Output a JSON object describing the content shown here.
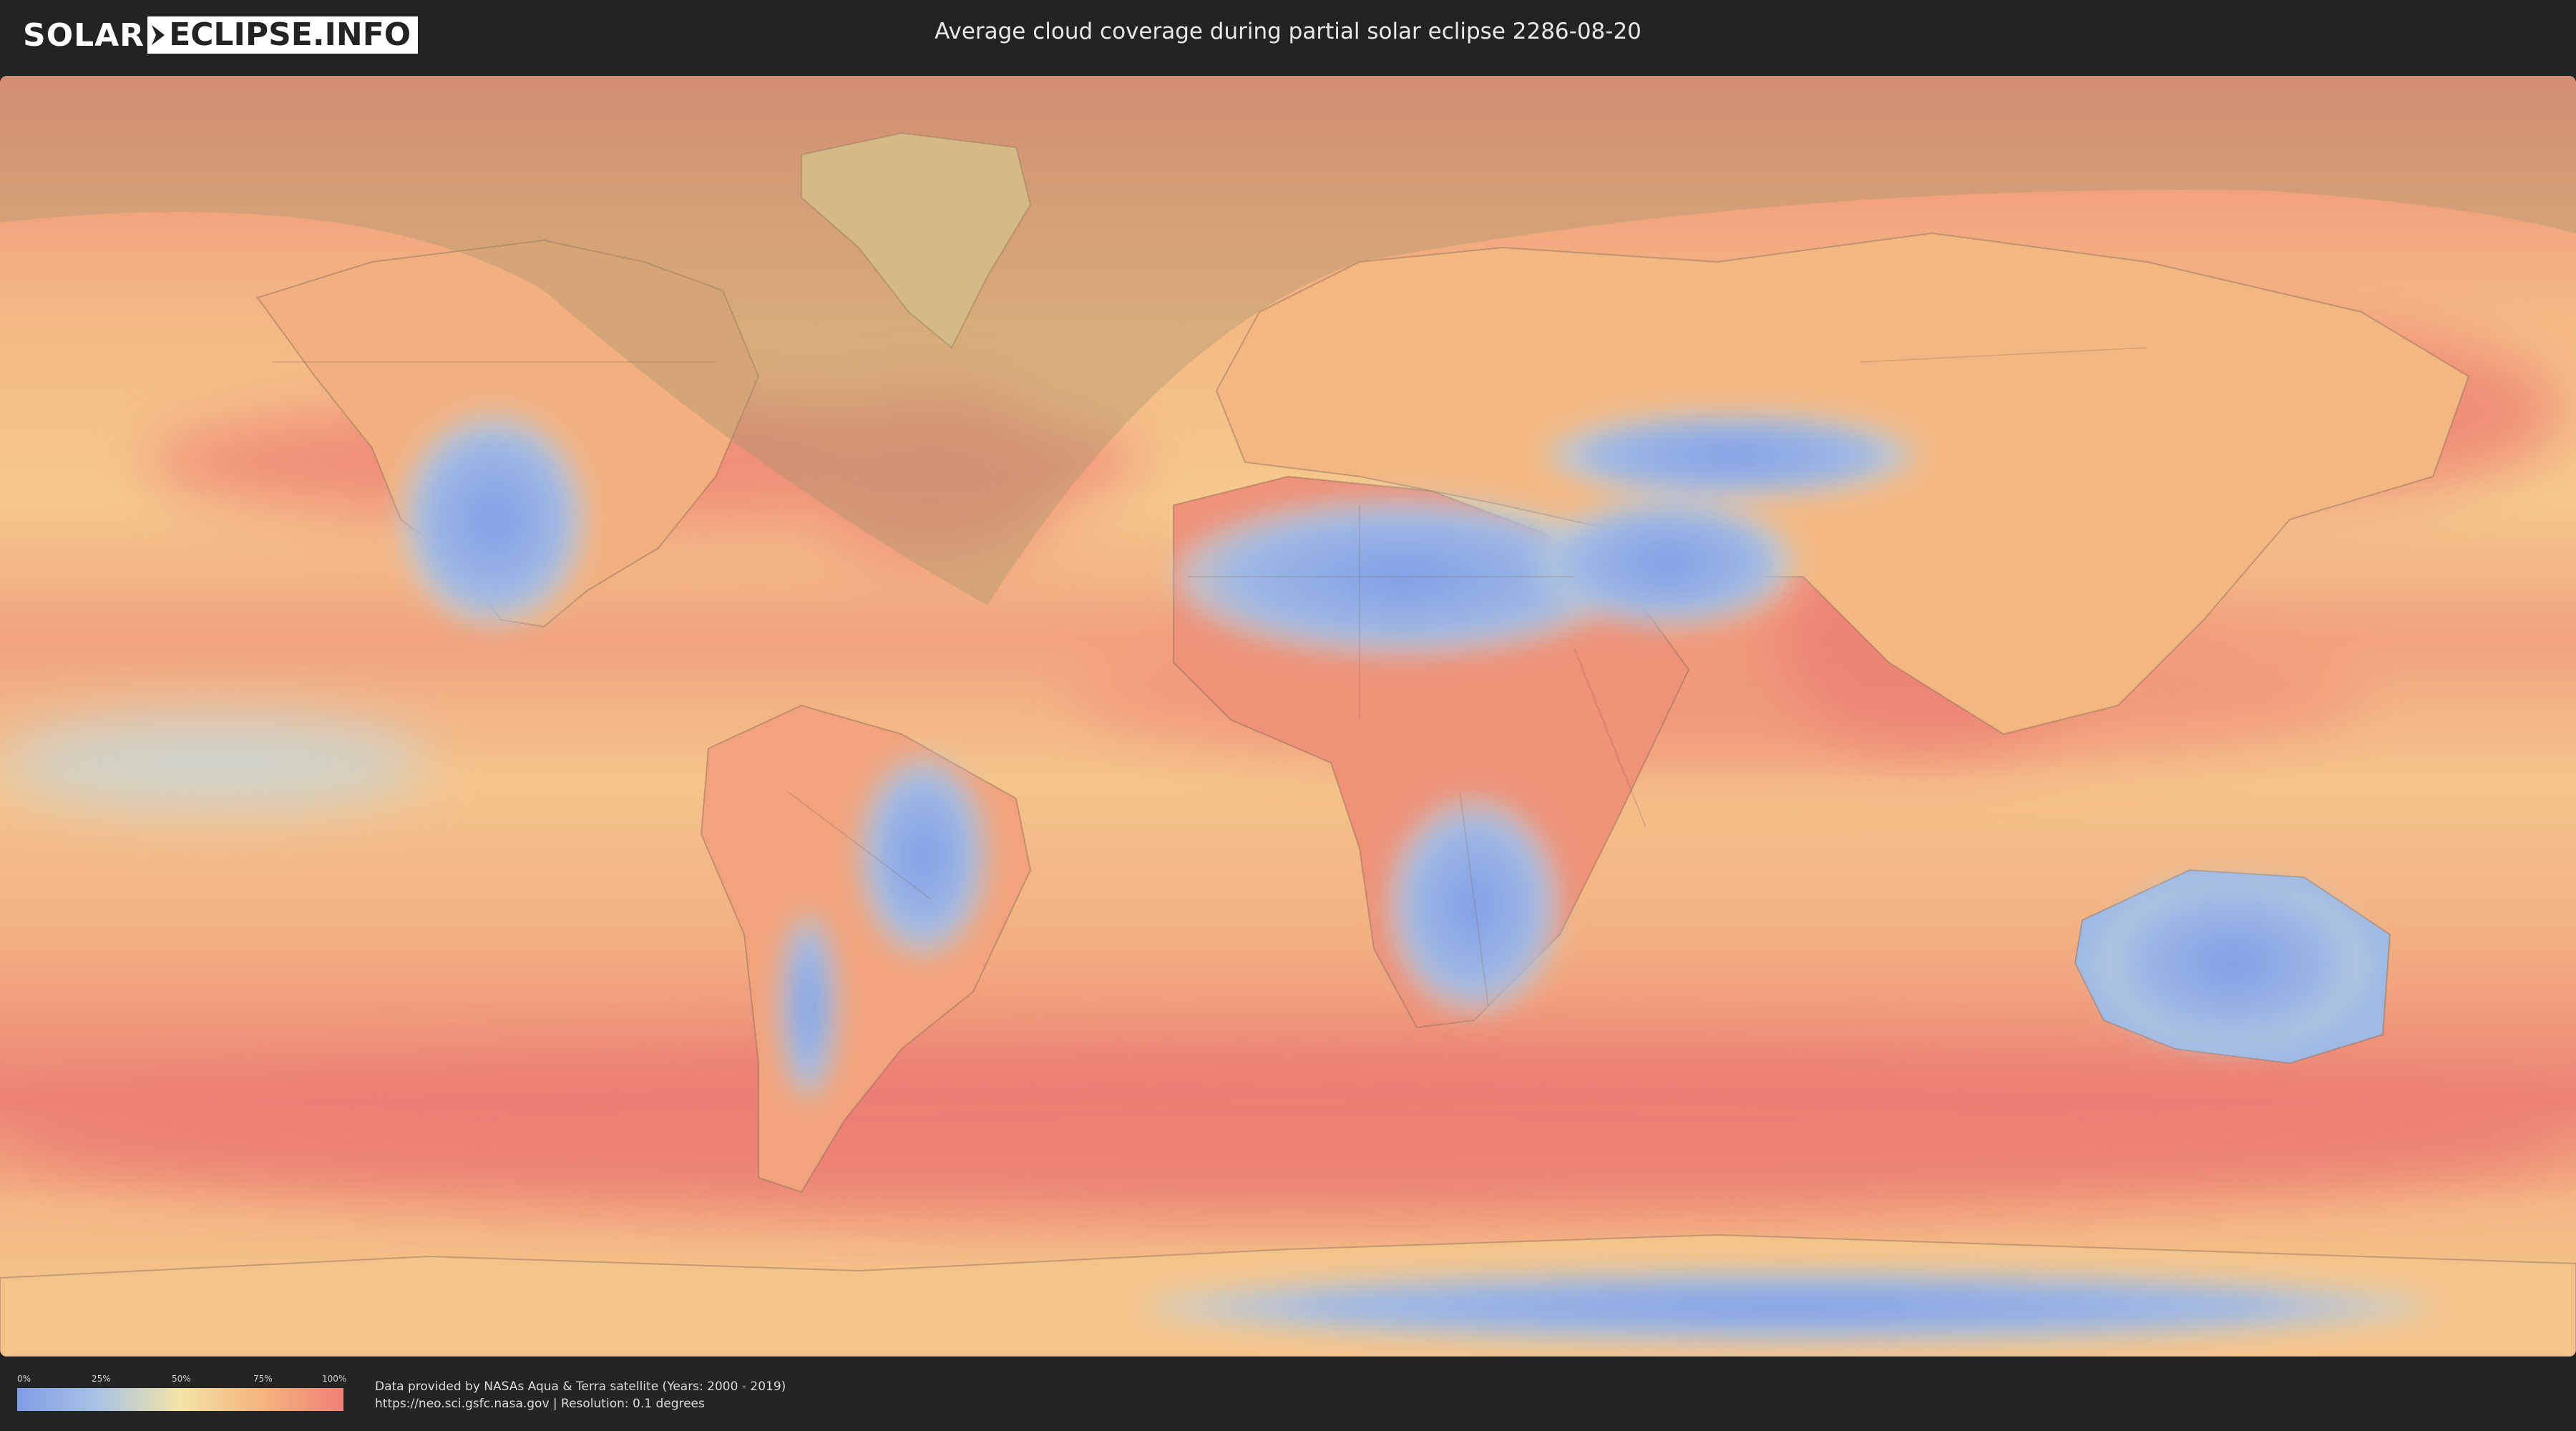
{
  "header": {
    "logo_left": "SOLAR",
    "logo_right": "ECLIPSE.INFO",
    "title": "Average cloud coverage during partial solar eclipse 2286-08-20"
  },
  "map": {
    "kind": "world cloud coverage map",
    "eclipse_visibility": "partial",
    "colors": {
      "ocean_base": "#f0a57d",
      "high_cloud": "#ec7f74",
      "mid_cloud": "#f6c98c",
      "low_cloud": "#8aa9e6",
      "eclipse_overlay": "#a89a6e"
    }
  },
  "legend": {
    "ticks": [
      "0%",
      "25%",
      "50%",
      "75%",
      "100%"
    ],
    "colors": [
      "#7f9de6",
      "#a8c3e3",
      "#f3e3a6",
      "#f4b47c",
      "#ee8076"
    ]
  },
  "source": {
    "line1": "Data provided by NASAs Aqua & Terra satellite (Years: 2000 - 2019)",
    "line2": "https://neo.sci.gsfc.nasa.gov | Resolution: 0.1 degrees"
  }
}
